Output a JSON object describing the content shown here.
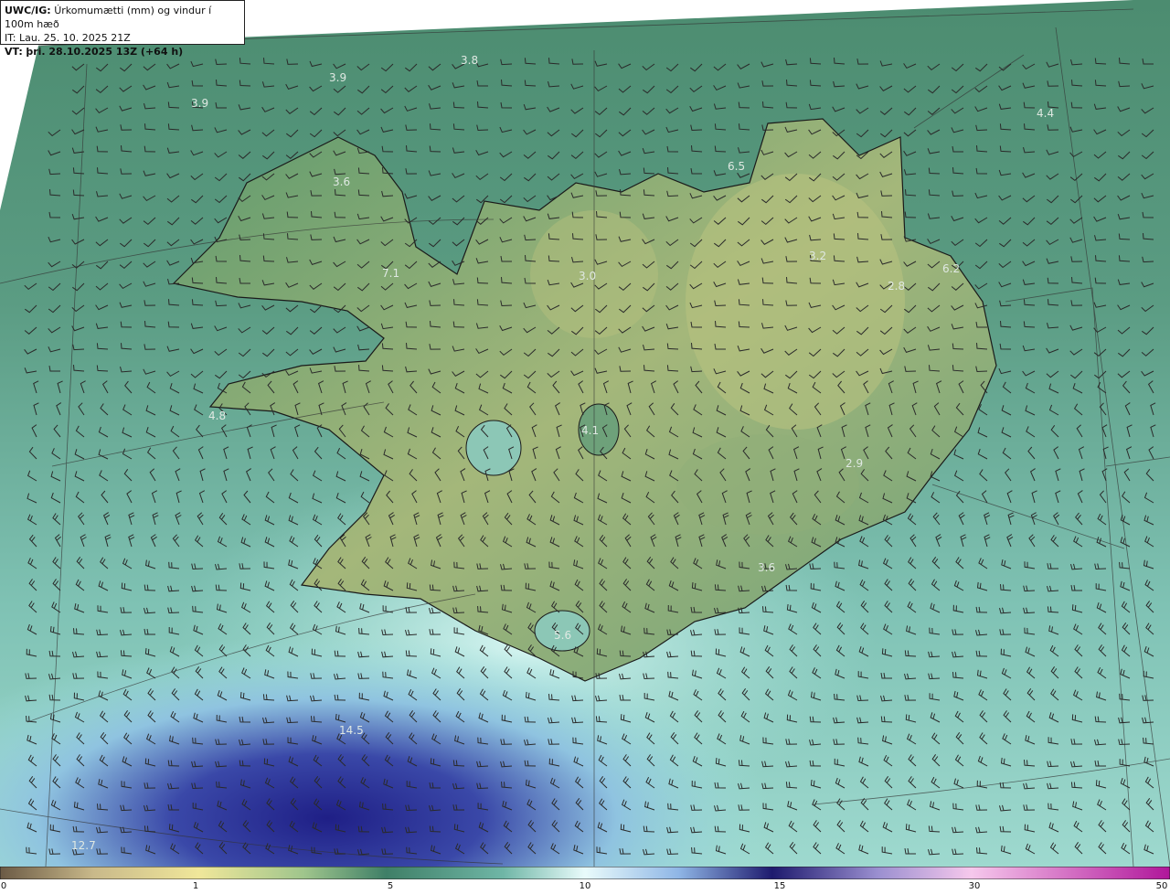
{
  "header": {
    "model_label": "UWC/IG:",
    "title": "Úrkomumætti (mm) og vindur í 100m hæð",
    "initial_time": "IT: Lau. 25. 10. 2025 21Z",
    "valid_label": "VT:",
    "valid_time": "þri. 28.10.2025 13Z (+64 h)"
  },
  "values": [
    {
      "text": "3.8"
    },
    {
      "text": "3.9"
    },
    {
      "text": "3.9"
    },
    {
      "text": "4.4"
    },
    {
      "text": "3.6"
    },
    {
      "text": "6.5"
    },
    {
      "text": "3.2"
    },
    {
      "text": "6.2"
    },
    {
      "text": "2.8"
    },
    {
      "text": "7.1"
    },
    {
      "text": "3.0"
    },
    {
      "text": "4.8"
    },
    {
      "text": "4.1"
    },
    {
      "text": "2.9"
    },
    {
      "text": "3.6"
    },
    {
      "text": "5.6"
    },
    {
      "text": "14.5"
    },
    {
      "text": "12.7"
    }
  ],
  "colorbar": {
    "ticks": [
      "0",
      "1",
      "5",
      "10",
      "15",
      "30",
      "50"
    ],
    "colors": [
      "#6b5a45",
      "#c9b98a",
      "#f0e79a",
      "#9fc58c",
      "#3f7f67",
      "#a8e4e2",
      "#e9fbfb",
      "#2a2f8f",
      "#1e1a6e",
      "#f6c8ec",
      "#b0169a"
    ]
  }
}
